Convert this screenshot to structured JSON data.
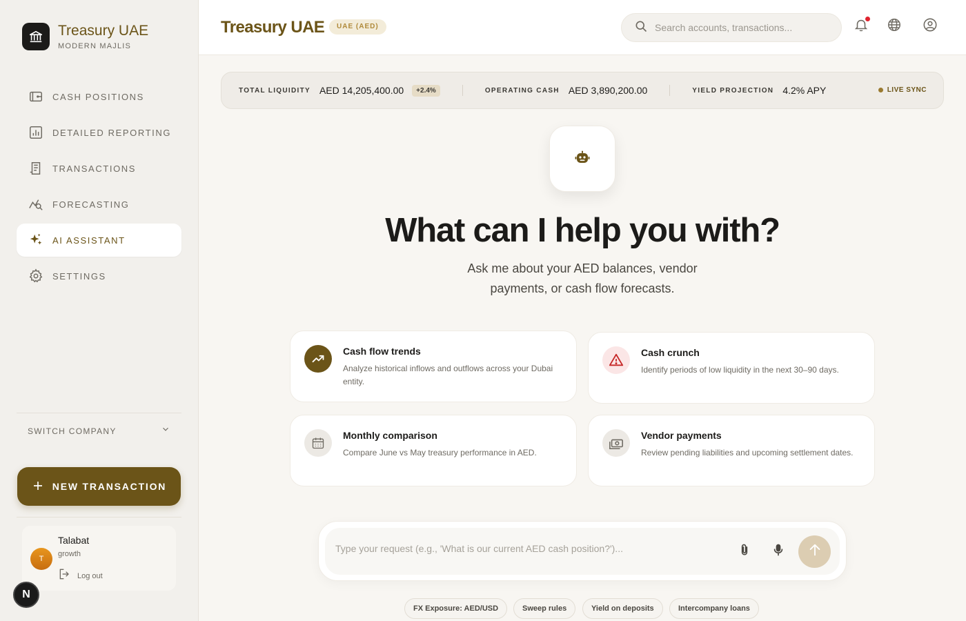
{
  "sidebar": {
    "brand_name": "Treasury UAE",
    "brand_sub": "MODERN MAJLIS",
    "nav": [
      {
        "label": "CASH POSITIONS",
        "icon": "wallet-icon"
      },
      {
        "label": "DETAILED REPORTING",
        "icon": "report-chart-icon"
      },
      {
        "label": "TRANSACTIONS",
        "icon": "receipt-icon"
      },
      {
        "label": "FORECASTING",
        "icon": "forecast-search-icon"
      },
      {
        "label": "AI ASSISTANT",
        "icon": "sparkles-icon",
        "active": true
      },
      {
        "label": "SETTINGS",
        "icon": "gear-icon"
      }
    ],
    "switch_company": "SWITCH COMPANY",
    "new_transaction": "NEW TRANSACTION",
    "user": {
      "initial": "T",
      "name": "Talabat",
      "role": "growth",
      "logout": "Log out"
    },
    "next_badge": "N"
  },
  "header": {
    "title": "Treasury UAE",
    "currency": "UAE (AED)",
    "search_placeholder": "Search accounts, transactions..."
  },
  "stats": {
    "total_liquidity_label": "TOTAL LIQUIDITY",
    "total_liquidity_value": "AED 14,205,400.00",
    "total_liquidity_change": "+2.4%",
    "operating_cash_label": "OPERATING CASH",
    "operating_cash_value": "AED 3,890,200.00",
    "yield_label": "YIELD PROJECTION",
    "yield_value": "4.2% APY",
    "live": "LIVE SYNC"
  },
  "hero": {
    "title": "What can I help you with?",
    "subtitle": "Ask me about your AED balances, vendor payments, or cash flow forecasts."
  },
  "cards": [
    {
      "title": "Cash flow trends",
      "desc": "Analyze historical inflows and outflows across your Dubai entity.",
      "icon": "trending-up-icon"
    },
    {
      "title": "Cash crunch",
      "desc": "Identify periods of low liquidity in the next 30–90 days.",
      "icon": "warning-icon"
    },
    {
      "title": "Monthly comparison",
      "desc": "Compare June vs May treasury performance in AED.",
      "icon": "calendar-icon"
    },
    {
      "title": "Vendor payments",
      "desc": "Review pending liabilities and upcoming settlement dates.",
      "icon": "banknote-icon"
    }
  ],
  "prompt": {
    "placeholder": "Type your request (e.g., 'What is our current AED cash position?')..."
  },
  "chips": [
    "FX Exposure: AED/USD",
    "Sweep rules",
    "Yield on deposits",
    "Intercompany loans"
  ],
  "colors": {
    "accent": "#6b5418",
    "alert": "#c62828",
    "live_dot": "#9a7a30"
  }
}
